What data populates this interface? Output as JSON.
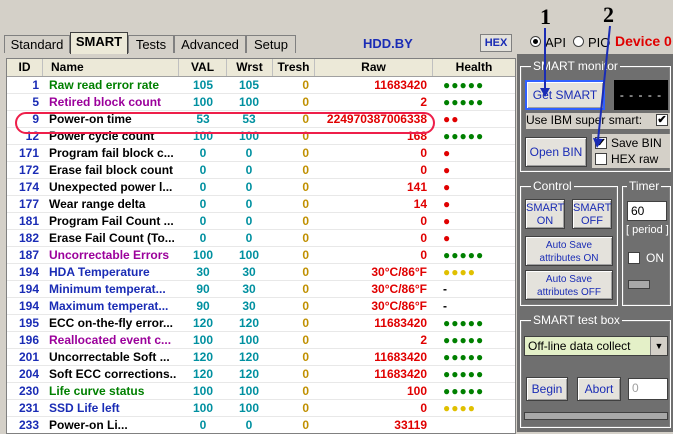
{
  "tabs": [
    {
      "label": "Standard",
      "active": false
    },
    {
      "label": "SMART",
      "active": true
    },
    {
      "label": "Tests",
      "active": false
    },
    {
      "label": "Advanced",
      "active": false
    },
    {
      "label": "Setup",
      "active": false
    }
  ],
  "header": {
    "app_title": "HDD.BY",
    "hex_label": "HEX",
    "api_label": "API",
    "pio_label": "PIO",
    "device_label": "Device 0",
    "annotation_1": "1",
    "annotation_2": "2"
  },
  "table": {
    "columns": [
      "ID",
      "Name",
      "VAL",
      "Wrst",
      "Tresh",
      "Raw",
      "Health"
    ],
    "rows": [
      {
        "id": "1",
        "name": "Raw read error rate",
        "val": "105",
        "wrst": "105",
        "tresh": "0",
        "raw": "11683420",
        "health": "●●●●●",
        "name_color": "#008000",
        "health_color": "#008000"
      },
      {
        "id": "5",
        "name": "Retired block count",
        "val": "100",
        "wrst": "100",
        "tresh": "0",
        "raw": "2",
        "health": "●●●●●",
        "name_color": "#9b009b",
        "health_color": "#008000"
      },
      {
        "id": "9",
        "name": "Power-on time",
        "val": "53",
        "wrst": "53",
        "tresh": "0",
        "raw": "22497038700633​8",
        "health": "●●",
        "name_color": "#000000",
        "health_color": "#e00000"
      },
      {
        "id": "12",
        "name": "Power cycle count",
        "val": "100",
        "wrst": "100",
        "tresh": "0",
        "raw": "168",
        "health": "●●●●●",
        "name_color": "#000000",
        "health_color": "#008000"
      },
      {
        "id": "171",
        "name": "Program fail block c...",
        "val": "0",
        "wrst": "0",
        "tresh": "0",
        "raw": "0",
        "health": "●",
        "name_color": "#000000",
        "health_color": "#e00000"
      },
      {
        "id": "172",
        "name": "Erase fail block count",
        "val": "0",
        "wrst": "0",
        "tresh": "0",
        "raw": "0",
        "health": "●",
        "name_color": "#000000",
        "health_color": "#e00000"
      },
      {
        "id": "174",
        "name": "Unexpected power l...",
        "val": "0",
        "wrst": "0",
        "tresh": "0",
        "raw": "141",
        "health": "●",
        "name_color": "#000000",
        "health_color": "#e00000"
      },
      {
        "id": "177",
        "name": "Wear range delta",
        "val": "0",
        "wrst": "0",
        "tresh": "0",
        "raw": "14",
        "health": "●",
        "name_color": "#000000",
        "health_color": "#e00000"
      },
      {
        "id": "181",
        "name": "Program Fail Count ...",
        "val": "0",
        "wrst": "0",
        "tresh": "0",
        "raw": "0",
        "health": "●",
        "name_color": "#000000",
        "health_color": "#e00000"
      },
      {
        "id": "182",
        "name": "Erase Fail Count (To...",
        "val": "0",
        "wrst": "0",
        "tresh": "0",
        "raw": "0",
        "health": "●",
        "name_color": "#000000",
        "health_color": "#e00000"
      },
      {
        "id": "187",
        "name": "Uncorrectable Errors",
        "val": "100",
        "wrst": "100",
        "tresh": "0",
        "raw": "0",
        "health": "●●●●●",
        "name_color": "#9b009b",
        "health_color": "#008000"
      },
      {
        "id": "194",
        "name": "HDA Temperature",
        "val": "30",
        "wrst": "30",
        "tresh": "0",
        "raw": "30°C/86°F",
        "health": "●●●●",
        "name_color": "#1a2cb5",
        "health_color": "#e0c000"
      },
      {
        "id": "194",
        "name": "Minimum temperat...",
        "val": "90",
        "wrst": "30",
        "tresh": "0",
        "raw": "30°C/86°F",
        "health": "-",
        "name_color": "#1a2cb5",
        "health_color": "#000000"
      },
      {
        "id": "194",
        "name": "Maximum temperat...",
        "val": "90",
        "wrst": "30",
        "tresh": "0",
        "raw": "30°C/86°F",
        "health": "-",
        "name_color": "#1a2cb5",
        "health_color": "#000000"
      },
      {
        "id": "195",
        "name": "ECC on-the-fly error...",
        "val": "120",
        "wrst": "120",
        "tresh": "0",
        "raw": "11683420",
        "health": "●●●●●",
        "name_color": "#000000",
        "health_color": "#008000"
      },
      {
        "id": "196",
        "name": "Reallocated event c...",
        "val": "100",
        "wrst": "100",
        "tresh": "0",
        "raw": "2",
        "health": "●●●●●",
        "name_color": "#9b009b",
        "health_color": "#008000"
      },
      {
        "id": "201",
        "name": "Uncorrectable Soft ...",
        "val": "120",
        "wrst": "120",
        "tresh": "0",
        "raw": "11683420",
        "health": "●●●●●",
        "name_color": "#000000",
        "health_color": "#008000"
      },
      {
        "id": "204",
        "name": "Soft ECC corrections...",
        "val": "120",
        "wrst": "120",
        "tresh": "0",
        "raw": "11683420",
        "health": "●●●●●",
        "name_color": "#000000",
        "health_color": "#008000"
      },
      {
        "id": "230",
        "name": "Life curve status",
        "val": "100",
        "wrst": "100",
        "tresh": "0",
        "raw": "100",
        "health": "●●●●●",
        "name_color": "#008000",
        "health_color": "#008000"
      },
      {
        "id": "231",
        "name": "SSD Life left",
        "val": "100",
        "wrst": "100",
        "tresh": "0",
        "raw": "0",
        "health": "●●●●",
        "name_color": "#1a2cb5",
        "health_color": "#e0c000"
      },
      {
        "id": "233",
        "name": "Power-on Li...",
        "val": "0",
        "wrst": "0",
        "tresh": "0",
        "raw": "33119",
        "health": "",
        "name_color": "#000000",
        "health_color": "#008000"
      }
    ]
  },
  "smart_monitor": {
    "title": "SMART monitor",
    "get_smart": "Get SMART",
    "display": "- - - - -",
    "ibm_label": "Use IBM super smart:",
    "ibm_checked": "✔",
    "open_bin": "Open BIN",
    "save_bin": "Save BIN",
    "save_bin_checked": "✔",
    "hex_raw": "HEX raw"
  },
  "control": {
    "title": "Control",
    "smart_on": "SMART\nON",
    "smart_on_l1": "SMART",
    "smart_on_l2": "ON",
    "smart_off_l1": "SMART",
    "smart_off_l2": "OFF",
    "auto_on_l1": "Auto Save",
    "auto_on_l2": "attributes ON",
    "auto_off_l1": "Auto Save",
    "auto_off_l2": "attributes OFF"
  },
  "timer": {
    "title": "Timer",
    "value": "60",
    "period": "[ period ]",
    "on_label": "ON"
  },
  "test_box": {
    "title": "SMART test box",
    "selected": "Off-line data collect",
    "begin": "Begin",
    "abort": "Abort",
    "value": "0"
  },
  "colors": {
    "accent": "#1a2cb5",
    "annotation": "#ee1f4a",
    "panel": "#6f6f6f"
  }
}
